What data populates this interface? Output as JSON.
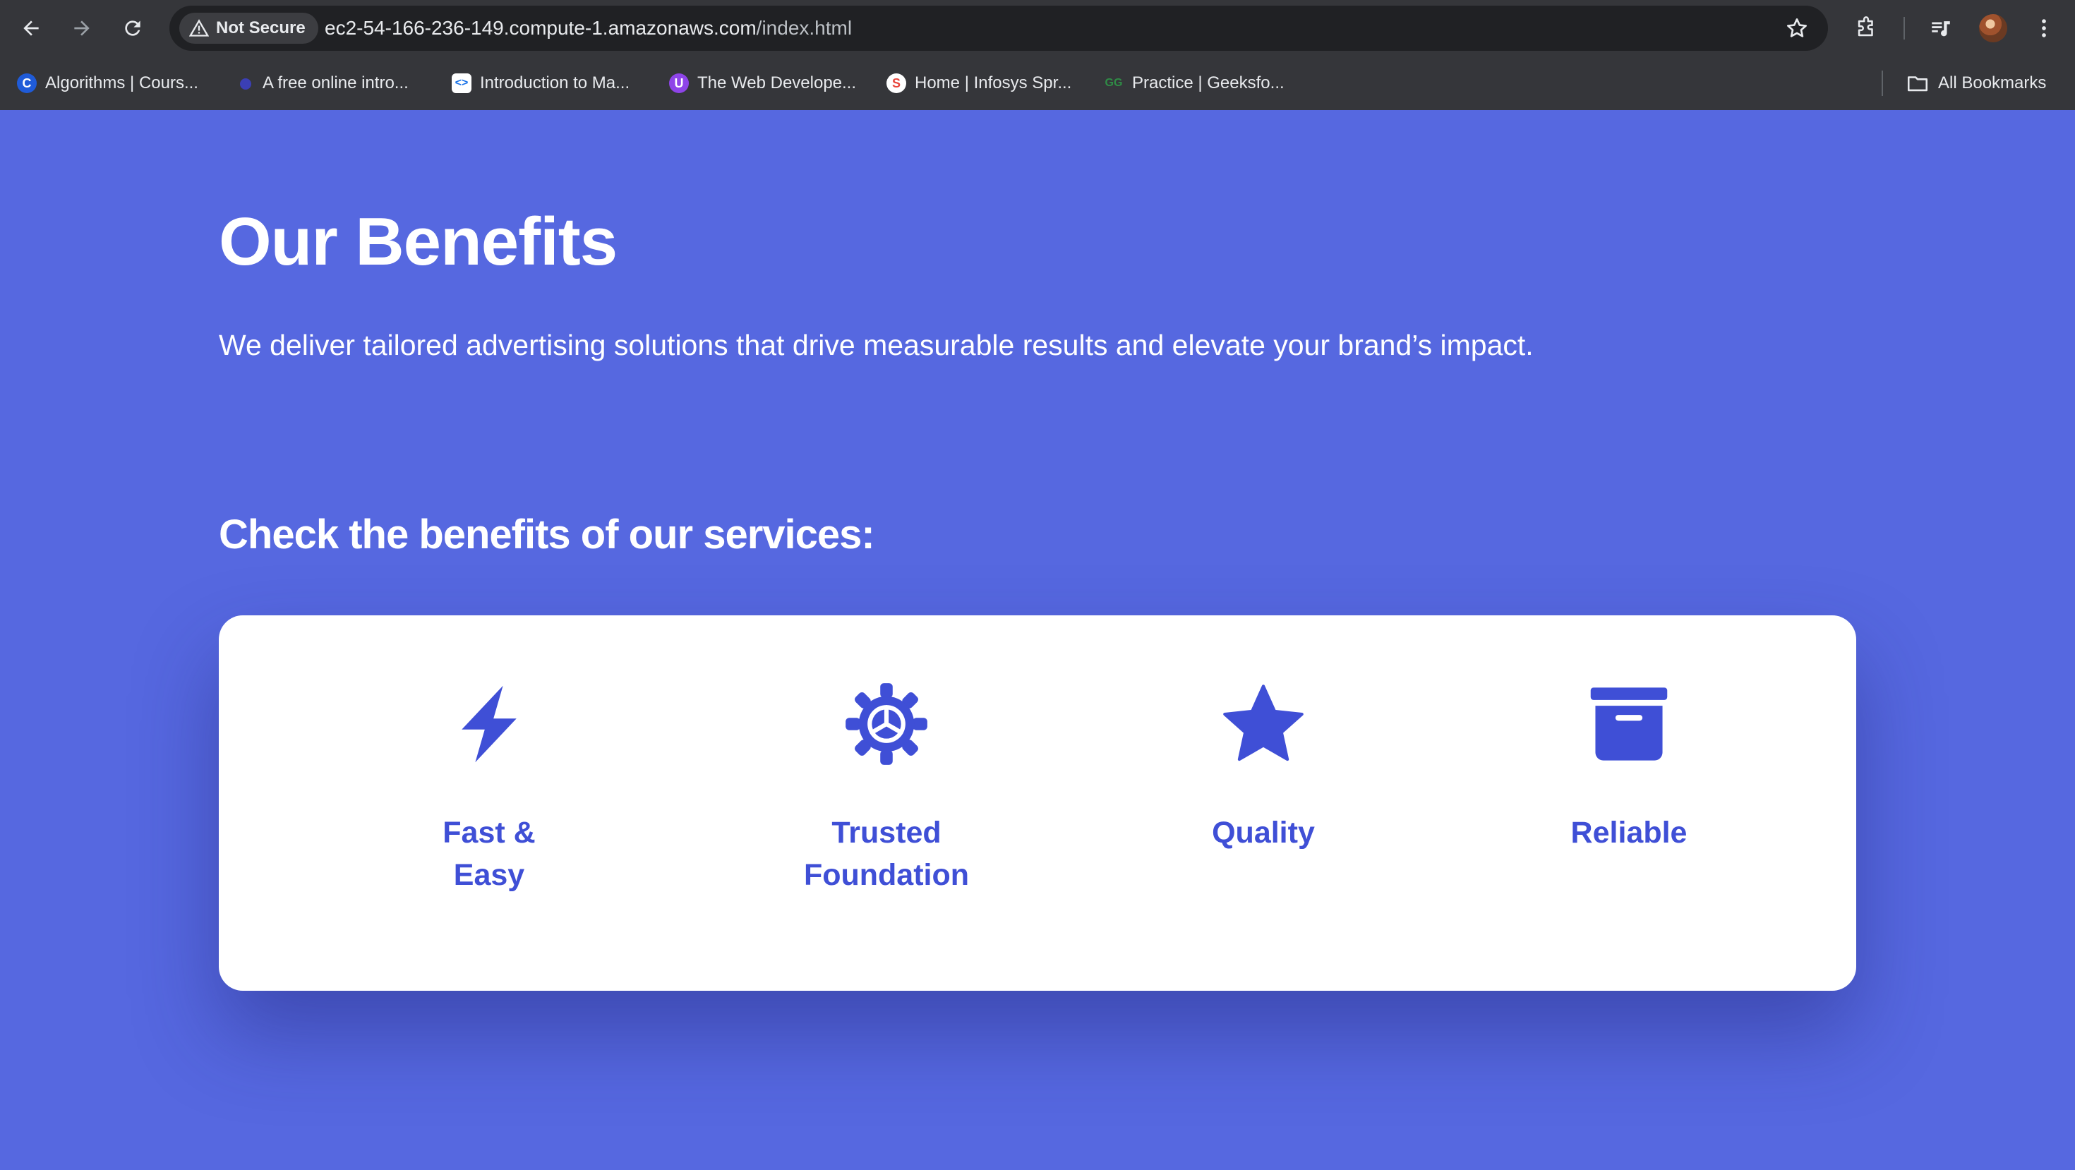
{
  "browser": {
    "security_chip": "Not Secure",
    "url_host": "ec2-54-166-236-149.compute-1.amazonaws.com",
    "url_path": "/index.html",
    "bookmarks": [
      {
        "label": "Algorithms | Cours...",
        "icon": "coursera-icon",
        "color": "#1f5bd8"
      },
      {
        "label": "A free online intro...",
        "icon": "dot-icon",
        "color": "#3b3fb5"
      },
      {
        "label": "Introduction to Ma...",
        "icon": "code-icon",
        "color": "#ffffff"
      },
      {
        "label": "The Web Develope...",
        "icon": "udemy-icon",
        "color": "#8e44e8"
      },
      {
        "label": "Home | Infosys Spr...",
        "icon": "springboard-icon",
        "color": "#e8463c"
      },
      {
        "label": "Practice | Geeksfo...",
        "icon": "geeksforgeeks-icon",
        "color": "#2f8d46"
      }
    ],
    "all_bookmarks": "All Bookmarks"
  },
  "hero": {
    "title": "Our Benefits",
    "subtitle": "We deliver tailored advertising solutions that drive measurable results and elevate your brand’s impact."
  },
  "benefits": {
    "heading": "Check the benefits of our services:",
    "items": [
      {
        "line1": "Fast &",
        "line2": "Easy",
        "icon": "lightning-icon"
      },
      {
        "line1": "Trusted",
        "line2": "Foundation",
        "icon": "gear-icon"
      },
      {
        "line1": "Quality",
        "line2": "",
        "icon": "star-icon"
      },
      {
        "line1": "Reliable",
        "line2": "",
        "icon": "archive-box-icon"
      }
    ]
  },
  "colors": {
    "page_background": "#5668e0",
    "accent": "#3f4fd6",
    "card_background": "#ffffff"
  }
}
